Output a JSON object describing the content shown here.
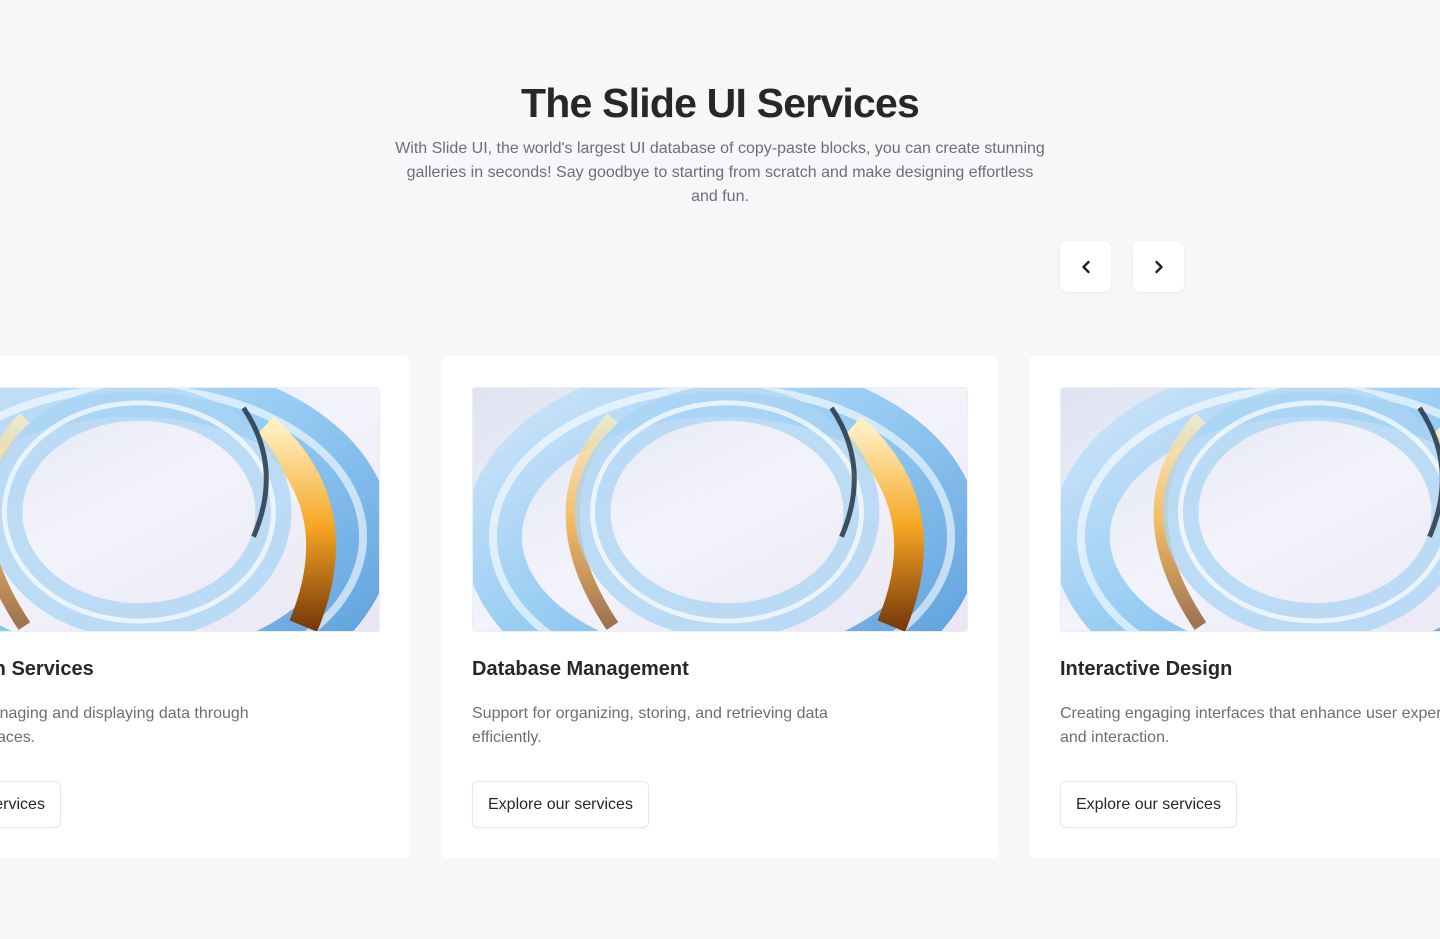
{
  "header": {
    "title": "The Slide UI Services",
    "description": "With Slide UI, the world's largest UI database of copy-paste blocks, you can create stunning galleries in seconds! Say goodbye to starting from scratch and make designing effortless and fun."
  },
  "carousel": {
    "prev_icon": "chevron-left-icon",
    "next_icon": "chevron-right-icon",
    "cards": [
      {
        "title": "Visualization Services",
        "text": "Solutions for managing and displaying data through interactive interfaces.",
        "button": "Explore our services",
        "image": "glass-ring-abstract"
      },
      {
        "title": "Database Management",
        "text": "Support for organizing, storing, and retrieving data efficiently.",
        "button": "Explore our services",
        "image": "glass-ring-abstract"
      },
      {
        "title": "Interactive Design",
        "text": "Creating engaging interfaces that enhance user experience and interaction.",
        "button": "Explore our services",
        "image": "glass-ring-abstract"
      }
    ]
  },
  "colors": {
    "background": "#f6f7f9",
    "card": "#ffffff",
    "heading": "#252729",
    "body_text": "#6b6f75"
  }
}
